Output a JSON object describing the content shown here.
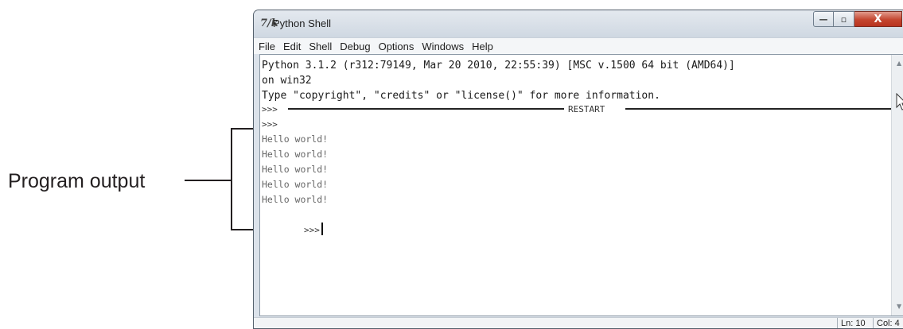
{
  "annotation": {
    "label": "Program output"
  },
  "window": {
    "title": "Python Shell",
    "app_icon": "7/k",
    "controls": {
      "minimize": "—",
      "maximize": "▫",
      "close": "X"
    }
  },
  "menu": [
    "File",
    "Edit",
    "Shell",
    "Debug",
    "Options",
    "Windows",
    "Help"
  ],
  "shell": {
    "banner": [
      "Python 3.1.2 (r312:79149, Mar 20 2010, 22:55:39) [MSC v.1500 64 bit (AMD64)]",
      "on win32",
      "Type \"copyright\", \"credits\" or \"license()\" for more information."
    ],
    "prompt": ">>>",
    "restart_label": "RESTART",
    "output": [
      "Hello world!",
      "Hello world!",
      "Hello world!",
      "Hello world!",
      "Hello world!"
    ]
  },
  "status": {
    "line": "Ln: 10",
    "col": "Col: 4"
  },
  "icons": [
    "python-idle-icon",
    "minimize-icon",
    "maximize-icon",
    "close-icon",
    "scroll-up-icon",
    "scroll-down-icon",
    "mouse-pointer-icon"
  ]
}
